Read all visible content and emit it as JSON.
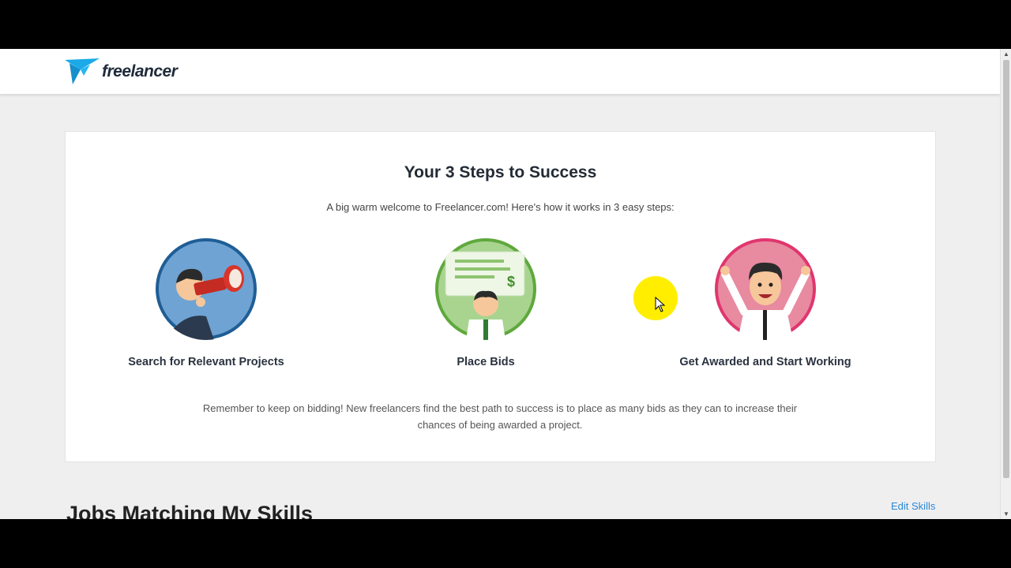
{
  "brand": {
    "name": "freelancer"
  },
  "intro": {
    "title": "Your 3 Steps to Success",
    "subtitle": "A big warm welcome to Freelancer.com! Here's how it works in 3 easy steps:",
    "steps": [
      {
        "label": "Search for Relevant Projects",
        "icon": "telescope-man-icon",
        "ring_color": "#1f5e95"
      },
      {
        "label": "Place Bids",
        "icon": "check-bid-icon",
        "ring_color": "#5fa83d"
      },
      {
        "label": "Get Awarded and Start Working",
        "icon": "celebrating-man-icon",
        "ring_color": "#e0366e"
      }
    ],
    "note": "Remember to keep on bidding! New freelancers find the best path to success is to place as many bids as they can to increase their chances of being awarded a project."
  },
  "jobs": {
    "heading": "Jobs Matching My Skills",
    "edit_label": "Edit Skills"
  },
  "colors": {
    "accent": "#2a88d8",
    "brand_blue": "#1ba9e8",
    "cursor_highlight": "#ffee00"
  }
}
